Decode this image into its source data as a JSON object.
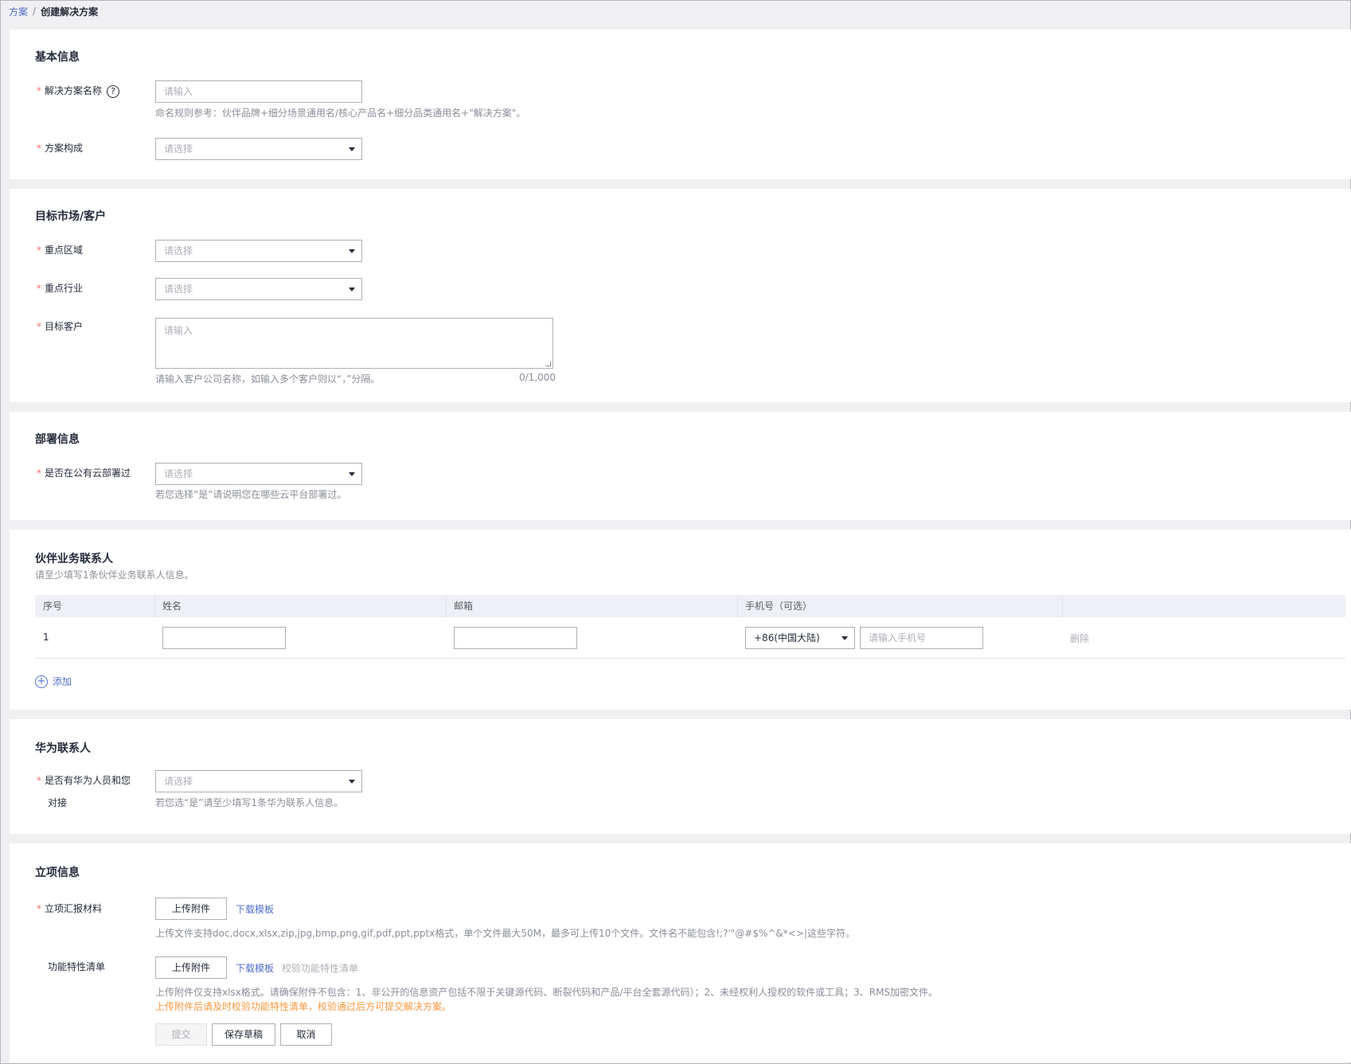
{
  "breadcrumb": {
    "parent": "方案",
    "separator": "/",
    "current": "创建解决方案"
  },
  "basic": {
    "title": "基本信息",
    "name_label": "解决方案名称",
    "name_placeholder": "请输入",
    "name_hint": "命名规则参考：伙伴品牌+细分场景通用名/核心产品名+细分品类通用名+\"解决方案\"。",
    "composition_label": "方案构成",
    "composition_placeholder": "请选择"
  },
  "market": {
    "title": "目标市场/客户",
    "region_label": "重点区域",
    "region_placeholder": "请选择",
    "industry_label": "重点行业",
    "industry_placeholder": "请选择",
    "customer_label": "目标客户",
    "customer_placeholder": "请输入",
    "customer_hint": "请输入客户公司名称，如输入多个客户则以“，”分隔。",
    "customer_counter": "0/1,000"
  },
  "deploy": {
    "title": "部署信息",
    "cloud_label": "是否在公有云部署过",
    "cloud_placeholder": "请选择",
    "cloud_hint": "若您选择“是”请说明您在哪些云平台部署过。"
  },
  "partner_contact": {
    "title": "伙伴业务联系人",
    "subtitle": "请至少填写1条伙伴业务联系人信息。",
    "columns": [
      "序号",
      "姓名",
      "邮箱",
      "手机号（可选）"
    ],
    "rows": [
      {
        "index": "1",
        "country_code": "+86(中国大陆)",
        "phone_placeholder": "请输入手机号",
        "delete": "删除"
      }
    ],
    "add_label": "添加"
  },
  "huawei_contact": {
    "title": "华为联系人",
    "label_line1": "是否有华为人员和您",
    "label_line2": "对接",
    "placeholder": "请选择",
    "hint": "若您选“是”请至少填写1条华为联系人信息。"
  },
  "project": {
    "title": "立项信息",
    "report_label": "立项汇报材料",
    "upload_label": "上传附件",
    "download_template": "下载模板",
    "report_hint": "上传文件支持doc,docx,xlsx,zip,jpg,bmp,png,gif,pdf,ppt,pptx格式，单个文件最大50M，最多可上传10个文件。文件名不能包含!;?'\"@#$%^&*<>|这些字符。",
    "feature_label": "功能特性清单",
    "feature_upload_label": "上传附件",
    "feature_download_template": "下载模板",
    "verify_feature": "校验功能特性清单",
    "feature_hint": "上传附件仅支持xlsx格式。请确保附件不包含：1、非公开的信息资产包括不限于关键源代码、断裂代码和产品/平台全套源代码）；2、未经权利人授权的软件或工具；3、RMS加密文件。",
    "feature_warning": "上传附件后请及时校验功能特性清单，校验通过后方可提交解决方案。"
  },
  "actions": {
    "submit": "提交",
    "save_draft": "保存草稿",
    "cancel": "取消"
  },
  "required_mark": "*"
}
